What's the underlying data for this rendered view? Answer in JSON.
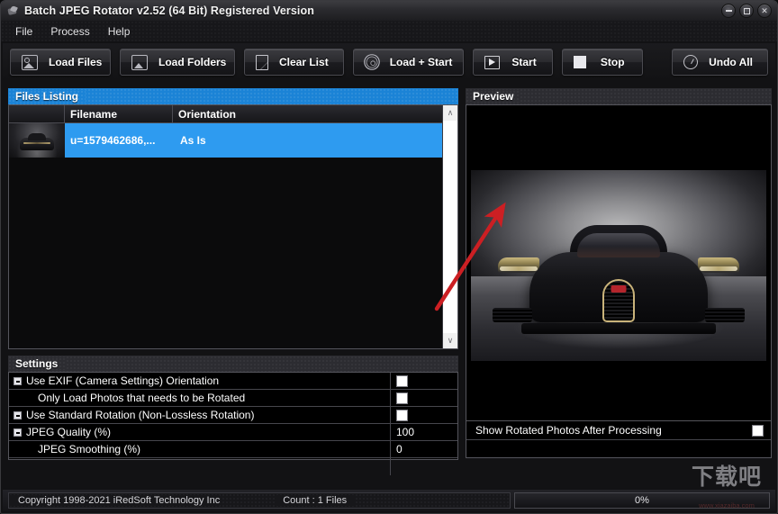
{
  "window": {
    "title": "Batch JPEG Rotator v2.52 (64 Bit) Registered Version",
    "icon": "app-icon",
    "controls": {
      "minimize": "minimize-button",
      "maximize": "maximize-button",
      "close": "✕"
    }
  },
  "menu": {
    "items": [
      "File",
      "Process",
      "Help"
    ]
  },
  "toolbar": {
    "buttons": [
      {
        "label": "Load Files",
        "icon": "photo-icon"
      },
      {
        "label": "Load Folders",
        "icon": "photos-icon"
      },
      {
        "label": "Clear List",
        "icon": "page-icon"
      },
      {
        "label": "Load + Start",
        "icon": "gear-icon"
      },
      {
        "label": "Start",
        "icon": "play-icon"
      },
      {
        "label": "Stop",
        "icon": "stop-icon"
      },
      {
        "label": "Undo All",
        "icon": "undo-icon"
      }
    ]
  },
  "files_listing": {
    "header": "Files Listing",
    "columns": [
      "",
      "Filename",
      "Orientation"
    ],
    "rows": [
      {
        "thumbnail": "car-thumbnail",
        "filename": "u=1579462686,...",
        "orientation": "As Is",
        "selected": true
      }
    ],
    "scrollbar": {
      "up": "∧",
      "down": "∨"
    }
  },
  "settings": {
    "header": "Settings",
    "rows": [
      {
        "label": "Use EXIF (Camera Settings) Orientation",
        "expander": true,
        "indent": false,
        "type": "checkbox",
        "value": "",
        "checked": false
      },
      {
        "label": "Only Load Photos that needs to be Rotated",
        "expander": false,
        "indent": true,
        "type": "checkbox",
        "value": "",
        "checked": false
      },
      {
        "label": "Use Standard Rotation (Non-Lossless Rotation)",
        "expander": true,
        "indent": false,
        "type": "checkbox",
        "value": "",
        "checked": false
      },
      {
        "label": "JPEG Quality (%)",
        "expander": true,
        "indent": false,
        "type": "text",
        "value": "100"
      },
      {
        "label": "JPEG Smoothing (%)",
        "expander": false,
        "indent": true,
        "type": "text",
        "value": "0"
      }
    ]
  },
  "preview": {
    "header": "Preview",
    "image_alt": "black-sports-car-photo",
    "annotation": "red-arrow-annotation"
  },
  "show_rotated": {
    "label": "Show Rotated Photos After Processing",
    "checked": false
  },
  "statusbar": {
    "copyright": "Copyright 1998-2021 iRedSoft Technology Inc",
    "count": "Count : 1 Files",
    "progress_text": "0%",
    "progress_value": 0
  },
  "watermark": {
    "cn": "下载吧",
    "url": "www.xiazaiba.com"
  },
  "colors": {
    "accent_blue": "#1b83d6",
    "row_select": "#2e9bf0",
    "annotation_red": "#cc1f23",
    "window_bg": "#121214",
    "panel_border": "#55555c"
  }
}
